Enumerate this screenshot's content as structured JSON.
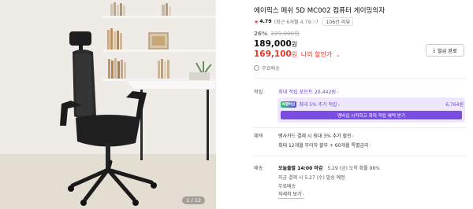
{
  "gallery": {
    "page_counter": "1 / 12"
  },
  "product": {
    "title": "에이픽스 메쉬 5D MC002 컴퓨터 게이밍의자",
    "rating": {
      "star_icon": "star-icon",
      "score": "4.79",
      "recent_note": "(최근 6개월 4.79",
      "recent_icon": "info-circle-icon",
      "recent_close": ")",
      "reviews_label": "106건 리뷰"
    },
    "discount_percent": "26%",
    "original_price": "229,000원",
    "price": "189,000",
    "price_unit": "원",
    "my_price": "169,100",
    "my_price_unit": "원",
    "my_price_label": "나의 할인가",
    "my_price_caret": "⌄",
    "shipping_label": "무료배송",
    "coupon_button_label": "발급 완료",
    "coupon_icon": "download-icon"
  },
  "points": {
    "section_label": "적립",
    "max_points_label": "최대 적립 포인트 20,442원",
    "membership": {
      "badge_label": "N멤버십",
      "text": "최대 5% 추가 적립",
      "points": "6,764원",
      "cta_label": "멤버십 시작하고 최대 적립 혜택 받기"
    }
  },
  "benefits": {
    "section_label": "혜택",
    "line1": "랭사카드 결제 시 최대 3% 추가 할인",
    "line2": "최대 12개월 무이자 할부 + 60개월 특별금리"
  },
  "delivery": {
    "section_label": "배송",
    "order_deadline": "오늘출발 14:00 마감",
    "arrival": "5.29 (금) 도착 확률 98%",
    "payment_note": "지금 결제 시 5.27 (수) 발송 예정",
    "fee": "무료배송",
    "detail_link": "자세히 보기"
  },
  "colors": {
    "accent_red": "#e6362a",
    "membership_purple": "#6a46d8",
    "membership_bg": "#efe8fd"
  }
}
